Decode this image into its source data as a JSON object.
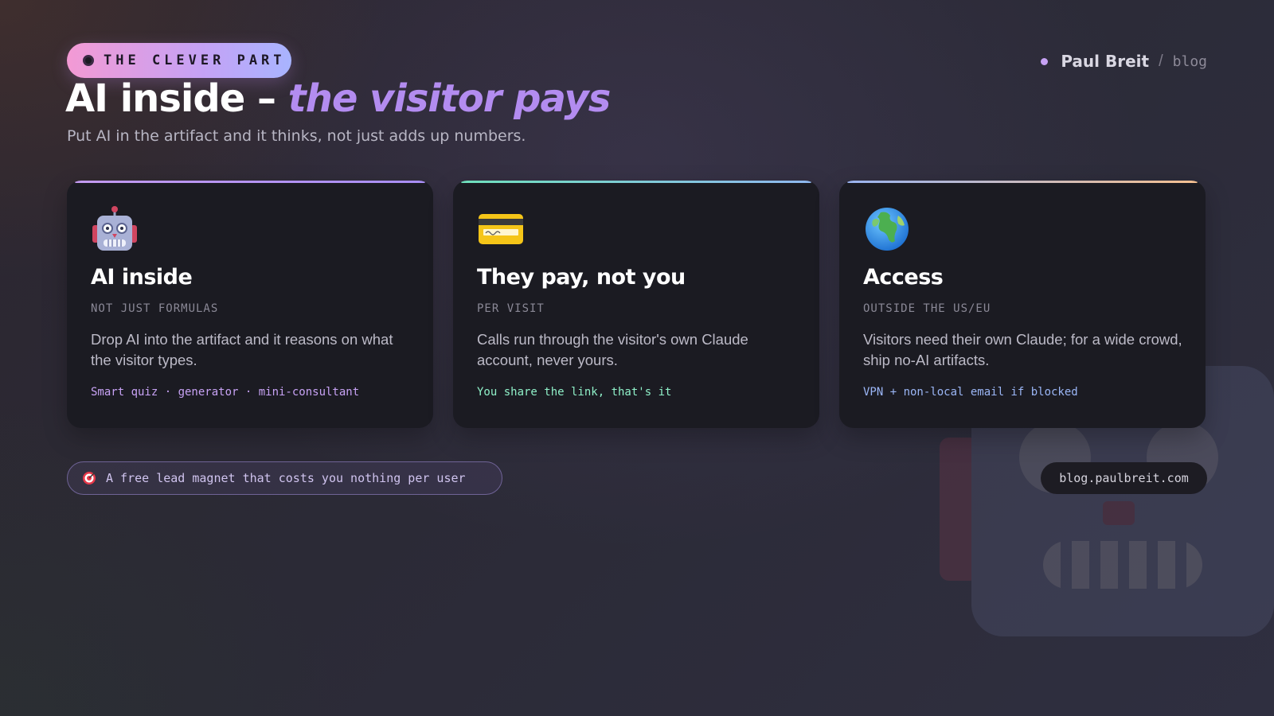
{
  "eyebrow": {
    "label": "THE CLEVER PART"
  },
  "brand": {
    "name": "Paul Breit",
    "separator": "/",
    "section": "blog"
  },
  "title": {
    "main": "AI inside – ",
    "accent": "the visitor pays"
  },
  "subtitle": "Put AI in the artifact and it thinks, not just adds up numbers.",
  "cards": [
    {
      "icon": "robot-icon",
      "heading": "AI inside",
      "kicker": "NOT JUST FORMULAS",
      "body": "Drop AI into the artifact and it reasons on what the visitor types.",
      "foot": "Smart quiz · generator · mini-consultant",
      "accent": "#c39af0"
    },
    {
      "icon": "credit-card-icon",
      "heading": "They pay, not you",
      "kicker": "PER VISIT",
      "body": "Calls run through the visitor's own Claude account, never yours.",
      "foot": "You share the link, that's it",
      "accent": "#6fe0bc"
    },
    {
      "icon": "globe-icon",
      "heading": "Access",
      "kicker": "OUTSIDE THE US/EU",
      "body": "Visitors need their own Claude; for a wide crowd, ship no-AI artifacts.",
      "foot": "VPN + non-local email if blocked",
      "accent": "#9ab4f0"
    }
  ],
  "footer": {
    "note_icon": "target-icon",
    "note": "A free lead magnet that costs you nothing per user",
    "url": "blog.paulbreit.com"
  }
}
